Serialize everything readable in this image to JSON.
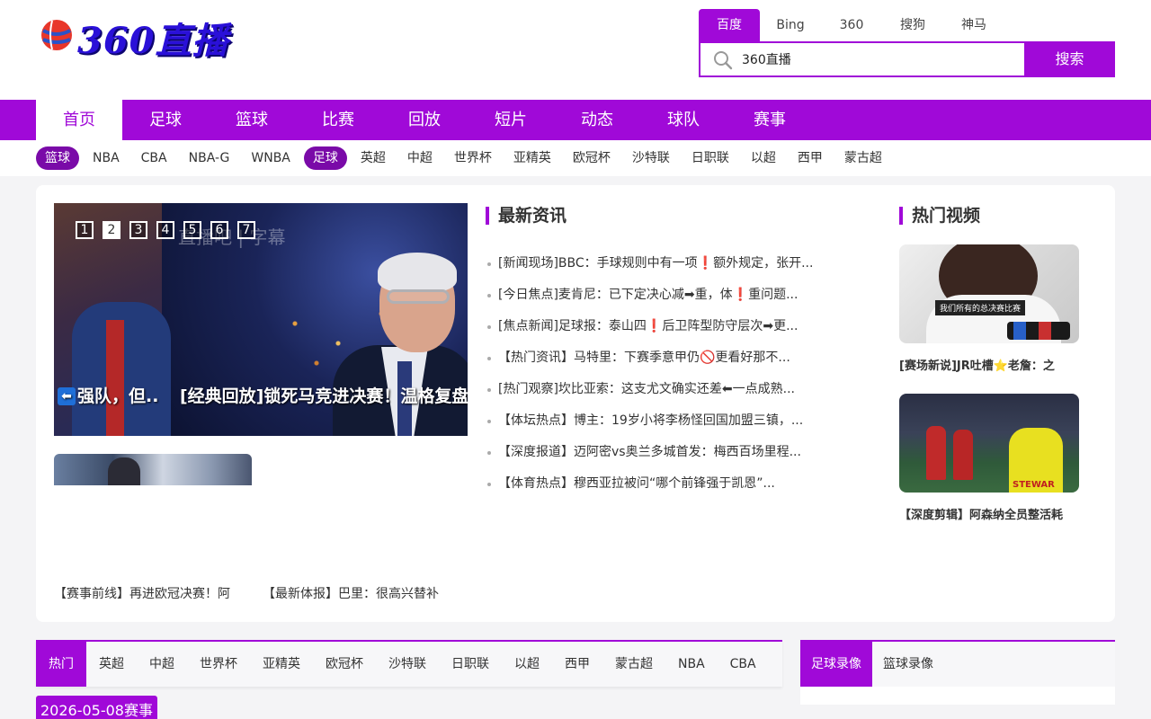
{
  "logo": {
    "text": "360直播"
  },
  "search": {
    "engines": [
      "百度",
      "Bing",
      "360",
      "搜狗",
      "神马"
    ],
    "active_engine": "百度",
    "query": "360直播",
    "button": "搜索"
  },
  "main_nav": [
    "首页",
    "足球",
    "篮球",
    "比赛",
    "回放",
    "短片",
    "动态",
    "球队",
    "赛事"
  ],
  "sub_nav": {
    "basketball_pill": "篮球",
    "basketball": [
      "NBA",
      "CBA",
      "NBA-G",
      "WNBA"
    ],
    "football_pill": "足球",
    "football": [
      "英超",
      "中超",
      "世界杯",
      "亚精英",
      "欧冠杯",
      "沙特联",
      "日职联",
      "以超",
      "西甲",
      "蒙古超"
    ]
  },
  "slider": {
    "numbers": [
      "1",
      "2",
      "3",
      "4",
      "5",
      "6",
      "7"
    ],
    "active": "2",
    "watermark": "直播吧 | 字幕",
    "caption_a": "强队，但..",
    "caption_b": "[经典回放]锁死马竞进决赛！温格复盘"
  },
  "bottom_captions": [
    "【赛事前线】再进欧冠决赛！阿",
    "【最新体报】巴里：很高兴替补"
  ],
  "latest_news": {
    "title": "最新资讯",
    "items": [
      "[新闻现场]BBC：手球规则中有一项❗额外规定，张开...",
      "[今日焦点]麦肯尼：已下定决心减➡重，体❗重问题...",
      "[焦点新闻]足球报：泰山四❗后卫阵型防守层次➡更...",
      "【热门资讯】马特里：下赛季意甲仍🚫更看好那不...",
      "[热门观察]坎比亚索：这支尤文确实还差⬅一点成熟...",
      "【体坛热点】博主：19岁小将李杨怪回国加盟三镇，...",
      "【深度报道】迈阿密vs奥兰多城首发：梅西百场里程...",
      "【体育热点】穆西亚拉被问“哪个前锋强于凯恩”..."
    ]
  },
  "hot_videos": {
    "title": "热门视频",
    "items": [
      {
        "title": "[赛场新说]JR吐槽⭐老詹：之",
        "overlay": "我们所有的总决赛比赛"
      },
      {
        "title": "【深度剪辑】阿森纳全员整活耗",
        "overlay": "STEWAR"
      }
    ]
  },
  "bottom_tabs": [
    "热门",
    "英超",
    "中超",
    "世界杯",
    "亚精英",
    "欧冠杯",
    "沙特联",
    "日职联",
    "以超",
    "西甲",
    "蒙古超",
    "NBA",
    "CBA"
  ],
  "bottom_active_tab": "热门",
  "date_badge": "2026-05-08赛事",
  "record_tabs": [
    "足球录像",
    "篮球录像"
  ],
  "record_active_tab": "足球录像",
  "colors": {
    "accent": "#a009d8",
    "pill": "#7a0aa8",
    "logo": "#2a10d8"
  },
  "icons": {
    "search": "search-icon",
    "logo_ball": "basketball-icon"
  }
}
